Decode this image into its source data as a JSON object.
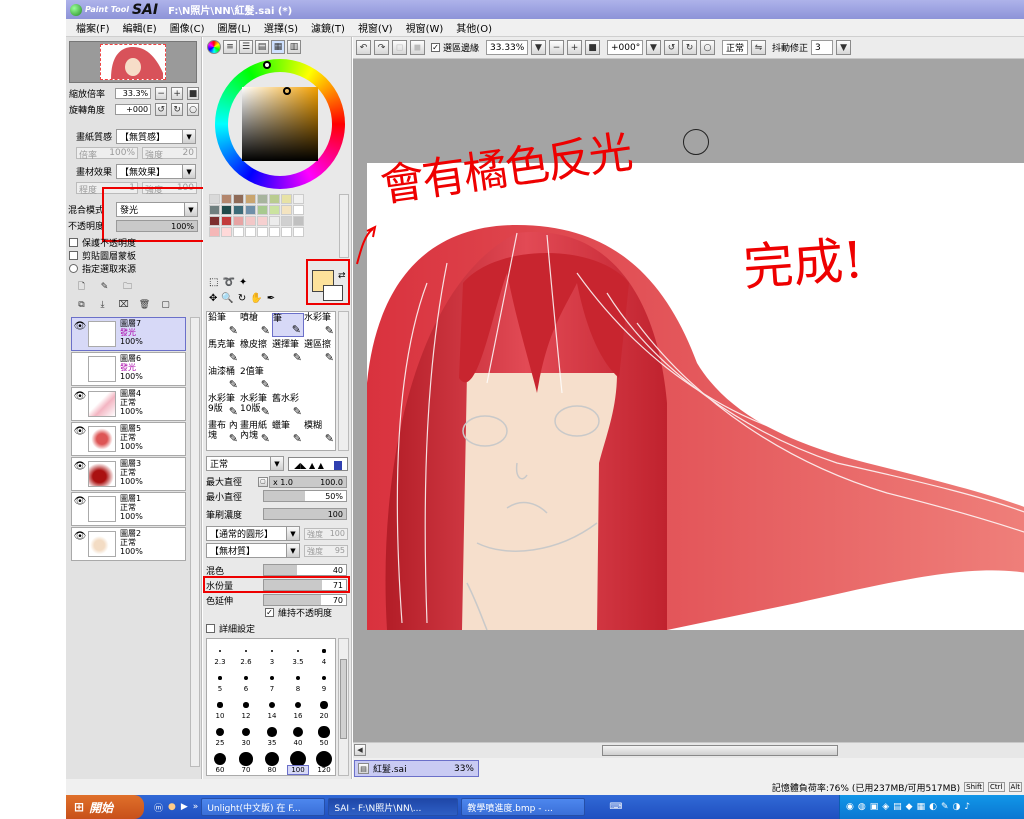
{
  "window": {
    "app_brand_small": "Paint Tool",
    "app_brand": "SAI",
    "title": "F:\\N照片\\NN\\紅髮.sai (*)"
  },
  "menu": [
    "檔案(F)",
    "編輯(E)",
    "圖像(C)",
    "圖層(L)",
    "選擇(S)",
    "濾鏡(T)",
    "視窗(V)",
    "視窗(W)",
    "其他(O)"
  ],
  "navigator": {
    "zoom_label": "縮放倍率",
    "zoom_value": "33.3%",
    "angle_label": "旋轉角度",
    "angle_value": "+000"
  },
  "paper": {
    "texture_label": "畫紙質感",
    "texture_value": "【無質感】",
    "scale_label": "倍率",
    "scale_value": "100%",
    "strength_label": "強度",
    "strength_value": "20",
    "effect_label": "畫材效果",
    "effect_value": "【無效果】",
    "degree_label": "程度",
    "degree_value": "1",
    "strength2_label": "強度",
    "strength2_value": "100"
  },
  "blend": {
    "mode_label": "混合模式",
    "mode_value": "發光",
    "opacity_label": "不透明度",
    "opacity_value": "100%",
    "opacity_fraction": 1.0
  },
  "layer_options": [
    "保護不透明度",
    "剪貼圖層蒙板",
    "指定選取來源"
  ],
  "layers": [
    {
      "name": "圖層7",
      "mode": "發光",
      "opacity": "100%",
      "selected": true
    },
    {
      "name": "圖層6",
      "mode": "發光",
      "opacity": "100%",
      "selected": false
    },
    {
      "name": "圖層4",
      "mode": "正常",
      "opacity": "100%",
      "selected": false
    },
    {
      "name": "圖層5",
      "mode": "正常",
      "opacity": "100%",
      "selected": false
    },
    {
      "name": "圖層3",
      "mode": "正常",
      "opacity": "100%",
      "selected": false
    },
    {
      "name": "圖層1",
      "mode": "正常",
      "opacity": "100%",
      "selected": false
    },
    {
      "name": "圖層2",
      "mode": "正常",
      "opacity": "100%",
      "selected": false
    }
  ],
  "colors": {
    "primary": "#fde29b",
    "accent": "#e00000",
    "swatches": [
      "#d9d9d9",
      "#b3866d",
      "#8f6b58",
      "#c9a56f",
      "#a7b49d",
      "#b9cc8f",
      "#e7e2a5",
      "#f1f1f1",
      "#6f7f7f",
      "#1f4a4a",
      "#3d6b78",
      "#6f8fa8",
      "#a7c98f",
      "#cbe3a0",
      "#f4e4c0",
      "#ffffff",
      "#7d2f2f",
      "#c23b3b",
      "#e6a3a3",
      "#f2c7c7",
      "#f6d0d0",
      "#ececec",
      "#d0d0d0",
      "#c0c0c0",
      "#f5b7b7",
      "#ffd9d9",
      "#ffffff",
      "#ffffff",
      "#ffffff",
      "#ffffff",
      "#ffffff",
      "#ffffff"
    ]
  },
  "tools": [
    {
      "label": "鉛筆"
    },
    {
      "label": "噴槍"
    },
    {
      "label": "筆"
    },
    {
      "label": "水彩筆"
    },
    {
      "label": "馬克筆"
    },
    {
      "label": "橡皮擦"
    },
    {
      "label": "選擇筆"
    },
    {
      "label": "選區擦"
    },
    {
      "label": "油漆桶"
    },
    {
      "label": "2值筆"
    },
    {
      "label": ""
    },
    {
      "label": ""
    },
    {
      "label": "水彩筆 9版"
    },
    {
      "label": "水彩筆 10版"
    },
    {
      "label": "舊水彩"
    },
    {
      "label": ""
    },
    {
      "label": "畫布 內塊"
    },
    {
      "label": "畫用紙 內塊"
    },
    {
      "label": "蠟筆"
    },
    {
      "label": "模糊"
    }
  ],
  "brush": {
    "mode_value": "正常",
    "max_size_label": "最大直徑",
    "max_size_mult": "x 1.0",
    "max_size_value": "100.0",
    "min_size_label": "最小直徑",
    "min_size_value": "50%",
    "min_size_fraction": 0.5,
    "density_label": "筆刷濃度",
    "density_value": "100",
    "density_fraction": 1.0,
    "shape_value": "【通常的圓形】",
    "shape_strength_label": "強度",
    "shape_strength_value": "100",
    "texture_value": "【無材質】",
    "texture_strength_label": "強度",
    "texture_strength_value": "95",
    "blend_label": "混色",
    "blend_value": "40",
    "blend_fraction": 0.4,
    "water_label": "水份量",
    "water_value": "71",
    "water_fraction": 0.71,
    "persist_label": "色延伸",
    "persist_value": "70",
    "persist_fraction": 0.7,
    "keep_opacity_label": "維持不透明度",
    "detail_label": "詳細設定"
  },
  "brush_sizes": [
    "2.3",
    "2.6",
    "3",
    "3.5",
    "4",
    "5",
    "6",
    "7",
    "8",
    "9",
    "10",
    "12",
    "14",
    "16",
    "20",
    "25",
    "30",
    "35",
    "40",
    "50",
    "60",
    "70",
    "80",
    "100",
    "120"
  ],
  "toolbar": {
    "selection_edge_label": "選區邊緣",
    "zoom_value": "33.33%",
    "angle_value": "+000°",
    "mode_value": "正常",
    "stabilizer_label": "抖動修正",
    "stabilizer_value": "3"
  },
  "annotations": {
    "note_color": "會有橘色反光",
    "note_done": "完成!"
  },
  "tab": {
    "name": "紅髮.sai",
    "zoom": "33%"
  },
  "status": {
    "memory": "記憶體負荷率:76% (已用237MB/可用517MB)",
    "keys": [
      "Shift",
      "Ctrl",
      "Alt"
    ]
  },
  "taskbar": {
    "start": "開始",
    "items": [
      "Unlight(中文版) 在 F...",
      "SAI - F:\\N照片\\NN\\...",
      "教學噴進度.bmp - ..."
    ]
  }
}
